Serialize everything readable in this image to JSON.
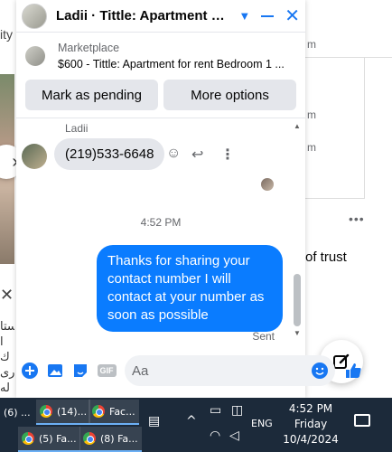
{
  "background": {
    "left_text": "ity",
    "chevron": "›",
    "close": "✕",
    "arabic_lines": [
      "ستا",
      "ا ك",
      "ری",
      "له"
    ],
    "card1_small": "m",
    "card2_small": "m",
    "card2_small_b": "m",
    "dots": "•••",
    "trust_text": "of trust"
  },
  "chat": {
    "title": "Ladii · Tittle: Apartment fo...",
    "marketplace": {
      "label": "Marketplace",
      "listing": "$600 - Tittle: Apartment for rent Bedroom 1 ..."
    },
    "buttons": {
      "mark_pending": "Mark as pending",
      "more_options": "More options"
    },
    "sender_name": "Ladii",
    "incoming_message": "(219)533-6648",
    "timestamp": "4:52 PM",
    "outgoing_message": "Thanks for sharing your contact number I will contact at your number as soon as possible",
    "sent_label": "Sent",
    "composer": {
      "placeholder": "Aa",
      "gif_label": "GIF"
    }
  },
  "taskbar": {
    "tasks": [
      {
        "label": "(6) ..."
      },
      {
        "label": "(14)..."
      },
      {
        "label": "Fac..."
      },
      {
        "label": "(5) Fa..."
      },
      {
        "label": "(8) Fa..."
      }
    ],
    "language": "ENG",
    "time": "4:52 PM",
    "day": "Friday",
    "date": "10/4/2024"
  },
  "colors": {
    "messenger_blue": "#0a7cff",
    "icon_blue": "#1877f2",
    "taskbar_bg": "#1c2a3a"
  }
}
